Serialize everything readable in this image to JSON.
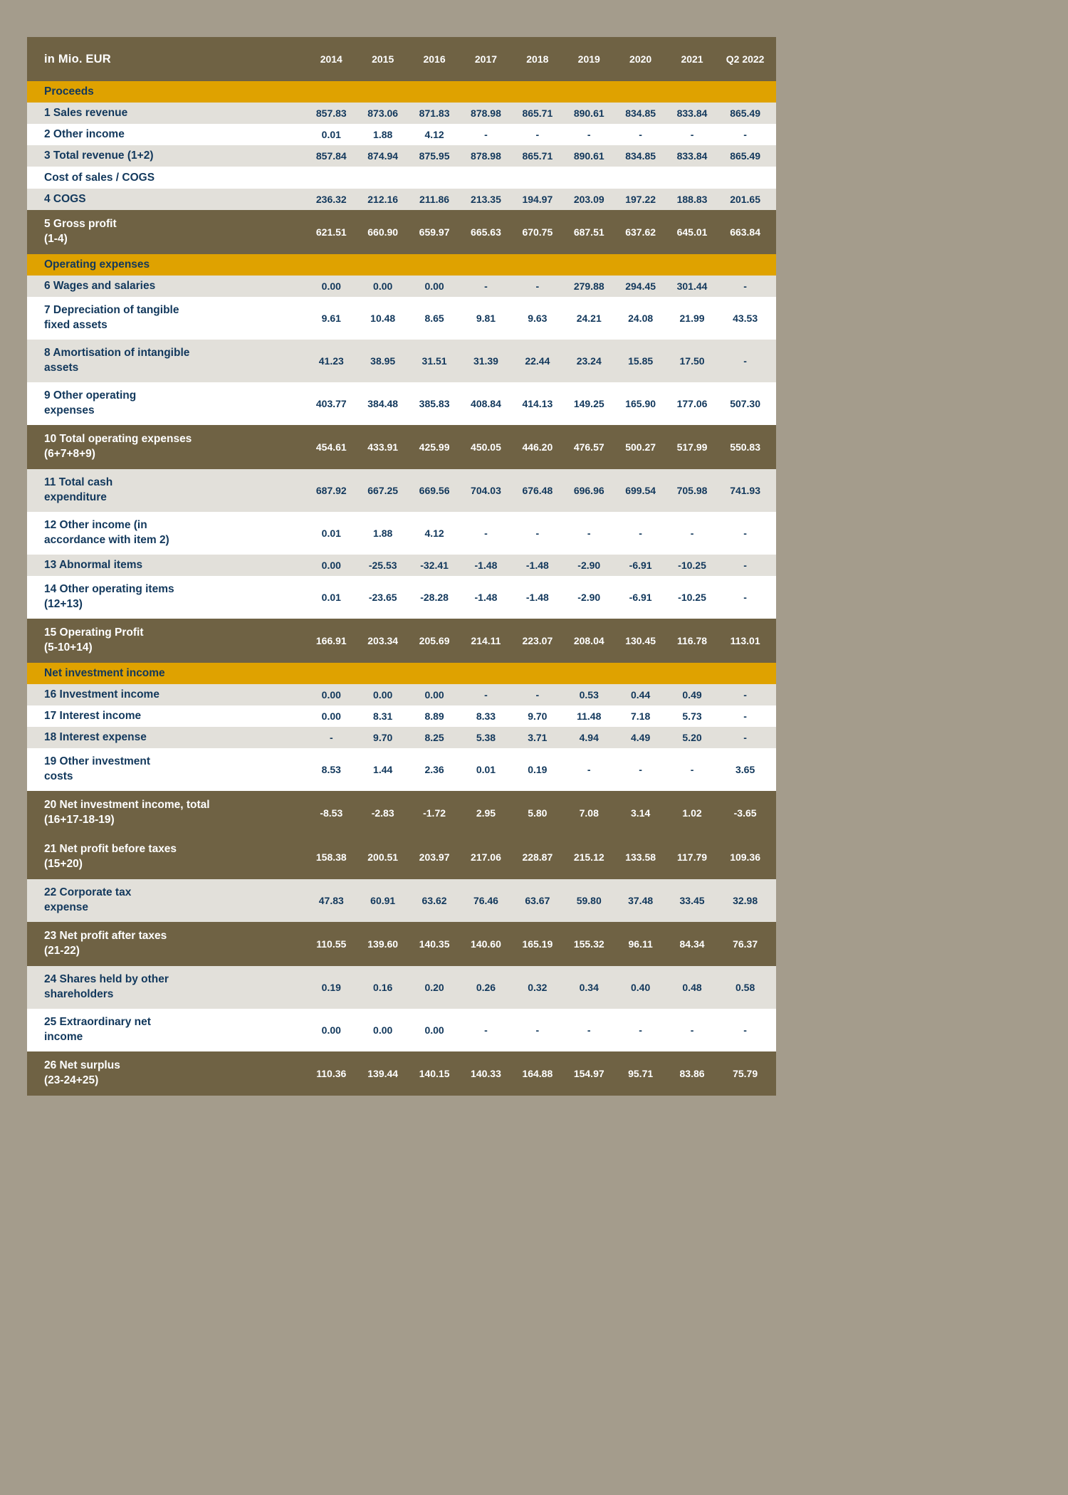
{
  "table": {
    "unit_header": "in Mio. EUR",
    "columns": [
      "2014",
      "2015",
      "2016",
      "2017",
      "2018",
      "2019",
      "2020",
      "2021",
      "Q2 2022"
    ],
    "rows": [
      {
        "kind": "section",
        "label": "Proceeds",
        "values": []
      },
      {
        "kind": "data",
        "label": "1 Sales revenue",
        "values": [
          "857.83",
          "873.06",
          "871.83",
          "878.98",
          "865.71",
          "890.61",
          "834.85",
          "833.84",
          "865.49"
        ]
      },
      {
        "kind": "data",
        "label": "2 Other income",
        "values": [
          "0.01",
          "1.88",
          "4.12",
          "-",
          "-",
          "-",
          "-",
          "-",
          "-"
        ]
      },
      {
        "kind": "data",
        "label": "3 Total revenue (1+2)",
        "values": [
          "857.84",
          "874.94",
          "875.95",
          "878.98",
          "865.71",
          "890.61",
          "834.85",
          "833.84",
          "865.49"
        ]
      },
      {
        "kind": "subhead",
        "label": "Cost of sales / COGS",
        "values": []
      },
      {
        "kind": "data",
        "label": "4 COGS",
        "values": [
          "236.32",
          "212.16",
          "211.86",
          "213.35",
          "194.97",
          "203.09",
          "197.22",
          "188.83",
          "201.65"
        ]
      },
      {
        "kind": "total",
        "label": "5 Gross profit\n(1-4)",
        "values": [
          "621.51",
          "660.90",
          "659.97",
          "665.63",
          "670.75",
          "687.51",
          "637.62",
          "645.01",
          "663.84"
        ]
      },
      {
        "kind": "section",
        "label": "Operating expenses",
        "values": []
      },
      {
        "kind": "data",
        "label": "6 Wages and salaries",
        "values": [
          "0.00",
          "0.00",
          "0.00",
          "-",
          "-",
          "279.88",
          "294.45",
          "301.44",
          "-"
        ]
      },
      {
        "kind": "data",
        "tall": true,
        "label": "7 Depreciation of tangible\nfixed assets",
        "values": [
          "9.61",
          "10.48",
          "8.65",
          "9.81",
          "9.63",
          "24.21",
          "24.08",
          "21.99",
          "43.53"
        ]
      },
      {
        "kind": "data",
        "tall": true,
        "label": "8 Amortisation of intangible\nassets",
        "values": [
          "41.23",
          "38.95",
          "31.51",
          "31.39",
          "22.44",
          "23.24",
          "15.85",
          "17.50",
          "-"
        ]
      },
      {
        "kind": "data",
        "tall": true,
        "label": "9 Other operating\nexpenses",
        "values": [
          "403.77",
          "384.48",
          "385.83",
          "408.84",
          "414.13",
          "149.25",
          "165.90",
          "177.06",
          "507.30"
        ]
      },
      {
        "kind": "total",
        "label": "10 Total operating expenses\n(6+7+8+9)",
        "values": [
          "454.61",
          "433.91",
          "425.99",
          "450.05",
          "446.20",
          "476.57",
          "500.27",
          "517.99",
          "550.83"
        ]
      },
      {
        "kind": "data",
        "tall": true,
        "label": "11 Total cash\nexpenditure",
        "values": [
          "687.92",
          "667.25",
          "669.56",
          "704.03",
          "676.48",
          "696.96",
          "699.54",
          "705.98",
          "741.93"
        ]
      },
      {
        "kind": "data",
        "tall": true,
        "label": "12 Other income (in\naccordance with item 2)",
        "values": [
          "0.01",
          "1.88",
          "4.12",
          "-",
          "-",
          "-",
          "-",
          "-",
          "-"
        ]
      },
      {
        "kind": "data",
        "label": "13 Abnormal items",
        "values": [
          "0.00",
          "-25.53",
          "-32.41",
          "-1.48",
          "-1.48",
          "-2.90",
          "-6.91",
          "-10.25",
          "-"
        ]
      },
      {
        "kind": "data",
        "tall": true,
        "label": "14 Other operating items\n(12+13)",
        "values": [
          "0.01",
          "-23.65",
          "-28.28",
          "-1.48",
          "-1.48",
          "-2.90",
          "-6.91",
          "-10.25",
          "-"
        ]
      },
      {
        "kind": "total",
        "label": "15 Operating Profit\n(5-10+14)",
        "values": [
          "166.91",
          "203.34",
          "205.69",
          "214.11",
          "223.07",
          "208.04",
          "130.45",
          "116.78",
          "113.01"
        ]
      },
      {
        "kind": "section",
        "label": "Net investment income",
        "values": []
      },
      {
        "kind": "data",
        "label": "16 Investment income",
        "values": [
          "0.00",
          "0.00",
          "0.00",
          "-",
          "-",
          "0.53",
          "0.44",
          "0.49",
          "-"
        ]
      },
      {
        "kind": "data",
        "label": "17 Interest income",
        "values": [
          "0.00",
          "8.31",
          "8.89",
          "8.33",
          "9.70",
          "11.48",
          "7.18",
          "5.73",
          "-"
        ]
      },
      {
        "kind": "data",
        "label": "18 Interest expense",
        "values": [
          "-",
          "9.70",
          "8.25",
          "5.38",
          "3.71",
          "4.94",
          "4.49",
          "5.20",
          "-"
        ]
      },
      {
        "kind": "data",
        "tall": true,
        "label": "19 Other investment\ncosts",
        "values": [
          "8.53",
          "1.44",
          "2.36",
          "0.01",
          "0.19",
          "-",
          "-",
          "-",
          "3.65"
        ]
      },
      {
        "kind": "total",
        "label": "20 Net investment income, total\n(16+17-18-19)",
        "values": [
          "-8.53",
          "-2.83",
          "-1.72",
          "2.95",
          "5.80",
          "7.08",
          "3.14",
          "1.02",
          "-3.65"
        ]
      },
      {
        "kind": "total",
        "label": "21 Net profit before taxes\n(15+20)",
        "values": [
          "158.38",
          "200.51",
          "203.97",
          "217.06",
          "228.87",
          "215.12",
          "133.58",
          "117.79",
          "109.36"
        ]
      },
      {
        "kind": "data",
        "tall": true,
        "label": "22 Corporate tax\nexpense",
        "values": [
          "47.83",
          "60.91",
          "63.62",
          "76.46",
          "63.67",
          "59.80",
          "37.48",
          "33.45",
          "32.98"
        ]
      },
      {
        "kind": "total",
        "label": "23 Net profit after taxes\n(21-22)",
        "values": [
          "110.55",
          "139.60",
          "140.35",
          "140.60",
          "165.19",
          "155.32",
          "96.11",
          "84.34",
          "76.37"
        ]
      },
      {
        "kind": "data",
        "tall": true,
        "label": "24 Shares held by other\nshareholders",
        "values": [
          "0.19",
          "0.16",
          "0.20",
          "0.26",
          "0.32",
          "0.34",
          "0.40",
          "0.48",
          "0.58"
        ]
      },
      {
        "kind": "data",
        "tall": true,
        "label": "25 Extraordinary net\nincome",
        "values": [
          "0.00",
          "0.00",
          "0.00",
          "-",
          "-",
          "-",
          "-",
          "-",
          "-"
        ]
      },
      {
        "kind": "total",
        "label": "26 Net surplus\n(23-24+25)",
        "values": [
          "110.36",
          "139.44",
          "140.15",
          "140.33",
          "164.88",
          "154.97",
          "95.71",
          "83.86",
          "75.79"
        ]
      }
    ]
  },
  "colors": {
    "page_background": "#a49c8c",
    "header_brown": "#6f6244",
    "section_gold": "#dfa200",
    "row_shade": "#e2e0da",
    "row_plain": "#ffffff",
    "text_navy": "#12385c",
    "text_white": "#ffffff"
  }
}
